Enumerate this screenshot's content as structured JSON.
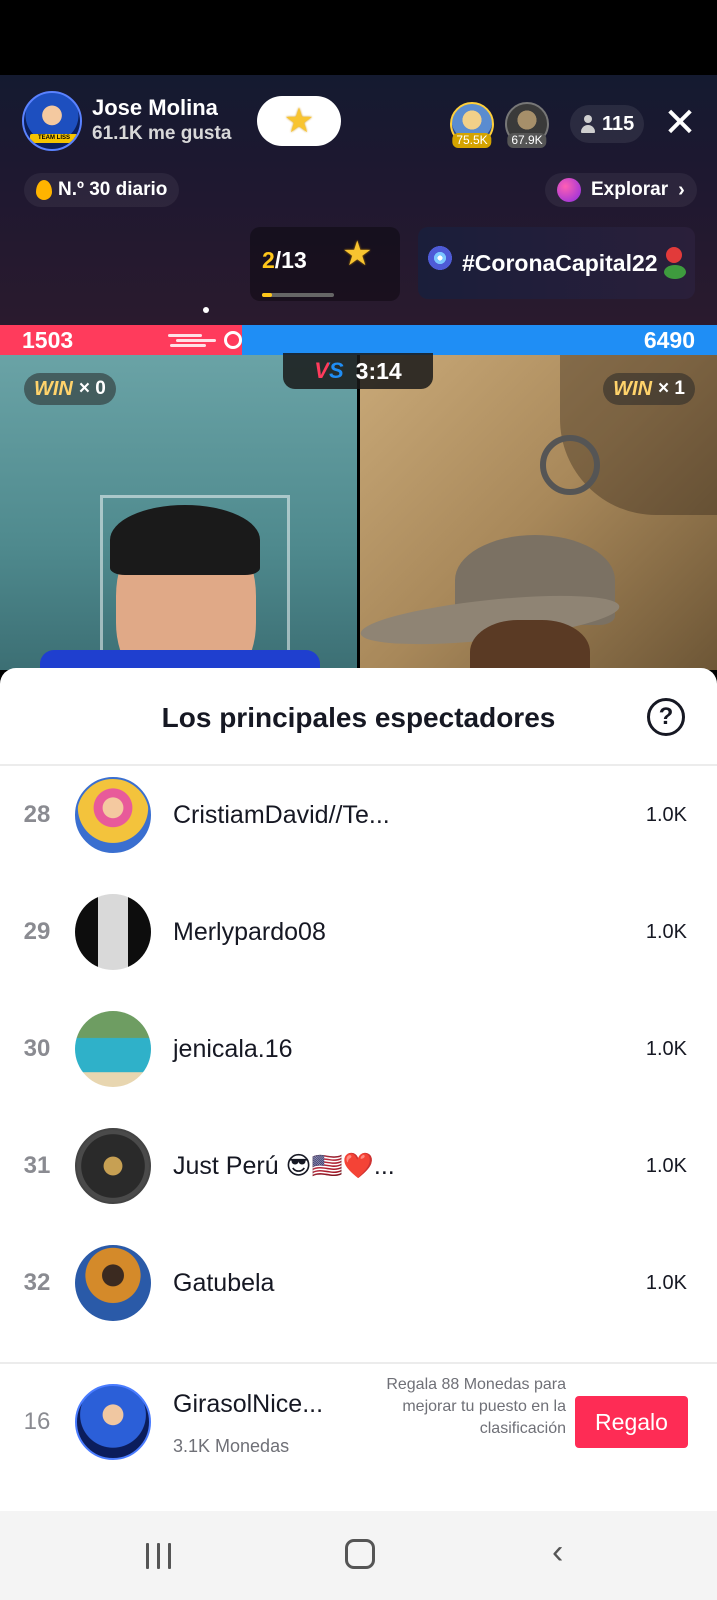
{
  "host": {
    "name": "Jose Molina",
    "likes": "61.1K me gusta",
    "avatar_tag": "TEAM LISS"
  },
  "top_viewers": [
    {
      "badge": "75.5K"
    },
    {
      "badge": "67.9K"
    }
  ],
  "viewer_count": "115",
  "daily_rank": "N.º 30 diario",
  "explore_label": "Explorar",
  "ranking": {
    "current": "2",
    "total": "/13"
  },
  "hashtag": "#CoronaCapital22",
  "battle": {
    "left_score": "1503",
    "right_score": "6490",
    "timer": "3:14",
    "vs_label": "VS",
    "left_win_label": "WIN",
    "left_win_count": "× 0",
    "right_win_label": "WIN",
    "right_win_count": "× 1"
  },
  "sheet": {
    "title": "Los principales espectadores",
    "rows": [
      {
        "rank": "28",
        "name": "CristiamDavid//Te...",
        "value": "1.0K"
      },
      {
        "rank": "29",
        "name": "Merlypardo08",
        "value": "1.0K"
      },
      {
        "rank": "30",
        "name": "jenicala.16",
        "value": "1.0K"
      },
      {
        "rank": "31",
        "name": "Just Perú 😎🇺🇸❤️...",
        "value": "1.0K"
      },
      {
        "rank": "32",
        "name": "Gatubela",
        "value": "1.0K"
      }
    ],
    "me": {
      "rank": "16",
      "name": "GirasolNice...",
      "coins": "3.1K Monedas",
      "hint": "Regala 88 Monedas para mejorar tu puesto en la clasificación",
      "gift_label": "Regalo"
    }
  },
  "colors": {
    "accent": "#fe2c55",
    "battle_red": "#ff3b5c",
    "battle_blue": "#1f8ef5",
    "rank_gold": "#ffc61a"
  },
  "icons": {
    "close": "close-icon",
    "help": "help-icon",
    "person": "person-icon",
    "star": "star-icon",
    "nav_recents": "recents-icon",
    "nav_home": "home-icon",
    "nav_back": "back-icon"
  }
}
